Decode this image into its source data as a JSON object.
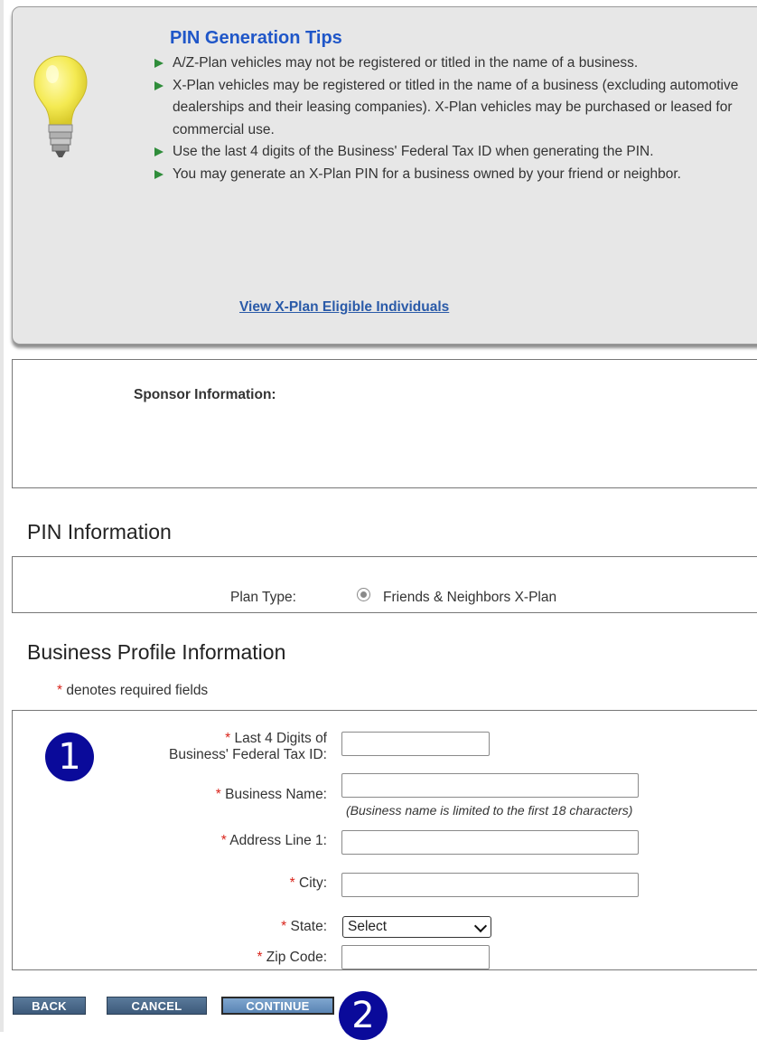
{
  "tips": {
    "title": "PIN Generation Tips",
    "items": [
      "A/Z-Plan vehicles may not be registered or titled in the name of a business.",
      "X-Plan vehicles may be registered or titled in the name of a business (excluding automotive dealerships and their leasing companies). X-Plan vehicles may be purchased or leased for commercial use.",
      "Use the last 4 digits of the Business' Federal Tax ID when generating the PIN.",
      "You may generate an X-Plan PIN for a business owned by your friend or neighbor."
    ],
    "link": "View X-Plan Eligible Individuals"
  },
  "sponsor": {
    "label": "Sponsor Information:"
  },
  "pin": {
    "title": "PIN Information",
    "plan_type_label": "Plan Type:",
    "plan_type_value": "Friends & Neighbors X-Plan"
  },
  "business": {
    "title": "Business Profile Information",
    "required_note": "denotes required fields",
    "tax_id_label_1": "Last 4 Digits of",
    "tax_id_label_2": "Business' Federal Tax ID:",
    "name_label": "Business Name:",
    "name_hint": "(Business name is limited to the first 18 characters)",
    "address_label": "Address Line 1:",
    "city_label": "City:",
    "state_label": "State:",
    "state_value": "Select",
    "zip_label": "Zip Code:",
    "tax_id_value": "",
    "name_value": "",
    "address_value": "",
    "city_value": "",
    "zip_value": ""
  },
  "buttons": {
    "back": "BACK",
    "cancel": "CANCEL",
    "continue": "CONTINUE"
  },
  "badges": {
    "one": "1",
    "two": "2"
  },
  "colors": {
    "title_blue": "#1f56c8",
    "required_red": "#d9241b",
    "button_blue": "#3d5a7a",
    "badge_navy": "#0a0a9a",
    "arrow_green": "#2f8d3a"
  }
}
